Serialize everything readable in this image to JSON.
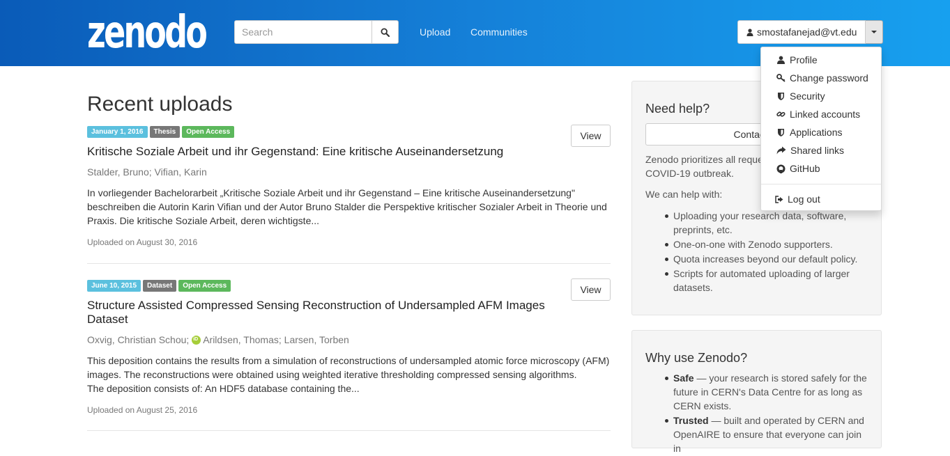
{
  "header": {
    "logo_text": "zenodo",
    "search_placeholder": "Search",
    "nav": [
      "Upload",
      "Communities"
    ],
    "user_email": "smostafanejad@vt.edu"
  },
  "user_menu": {
    "items": [
      "Profile",
      "Change password",
      "Security",
      "Linked accounts",
      "Applications",
      "Shared links",
      "GitHub"
    ],
    "logout": "Log out"
  },
  "main": {
    "title": "Recent uploads",
    "records": [
      {
        "date": "January 1, 2016",
        "type": "Thesis",
        "access": "Open Access",
        "title": "Kritische Soziale Arbeit und ihr Gegenstand: Eine kritische Auseinandersetzung",
        "authors": "Stalder, Bruno; Vifian, Karin",
        "description": "In vorliegender Bachelorarbeit „Kritische Soziale Arbeit und ihr Gegenstand – Eine kritische Auseinandersetzung\" beschreiben die Autorin Karin Vifian und der Autor Bruno Stalder die Perspektive kritischer Sozialer Arbeit in Theorie und Praxis. Die kritische Soziale Arbeit, deren wichtigste...",
        "uploaded": "Uploaded on August 30, 2016",
        "view_label": "View"
      },
      {
        "date": "June 10, 2015",
        "type": "Dataset",
        "access": "Open Access",
        "title": "Structure Assisted Compressed Sensing Reconstruction of Undersampled AFM Images Dataset",
        "author_a": "Oxvig, Christian Schou",
        "author_b": "Arildsen, Thomas",
        "author_c": "Larsen, Torben",
        "description_1": "This deposition contains the results from a simulation of reconstructions of undersampled atomic force microscopy (AFM) images. The reconstructions were obtained using weighted iterative thresholding compressed sensing algorithms.",
        "description_2": "The deposition consists of: An  HDF5 database containing the...",
        "uploaded": "Uploaded on August 25, 2016",
        "view_label": "View"
      }
    ]
  },
  "sidebar": {
    "help_title": "Need help?",
    "contact_label": "Contact us",
    "help_text": "Zenodo prioritizes all requests related to the COVID-19 outbreak.",
    "help_intro": "We can help with:",
    "help_items": [
      "Uploading your research data, software, preprints, etc.",
      "One-on-one with Zenodo supporters.",
      "Quota increases beyond our default policy.",
      "Scripts for automated uploading of larger datasets."
    ],
    "why_title": "Why use Zenodo?",
    "why_items": [
      {
        "bold": "Safe",
        "text": " — your research is stored safely for the future in CERN's Data Centre for as long as CERN exists."
      },
      {
        "bold": "Trusted",
        "text": " — built and operated by CERN and OpenAIRE to ensure that everyone can join in"
      }
    ]
  }
}
